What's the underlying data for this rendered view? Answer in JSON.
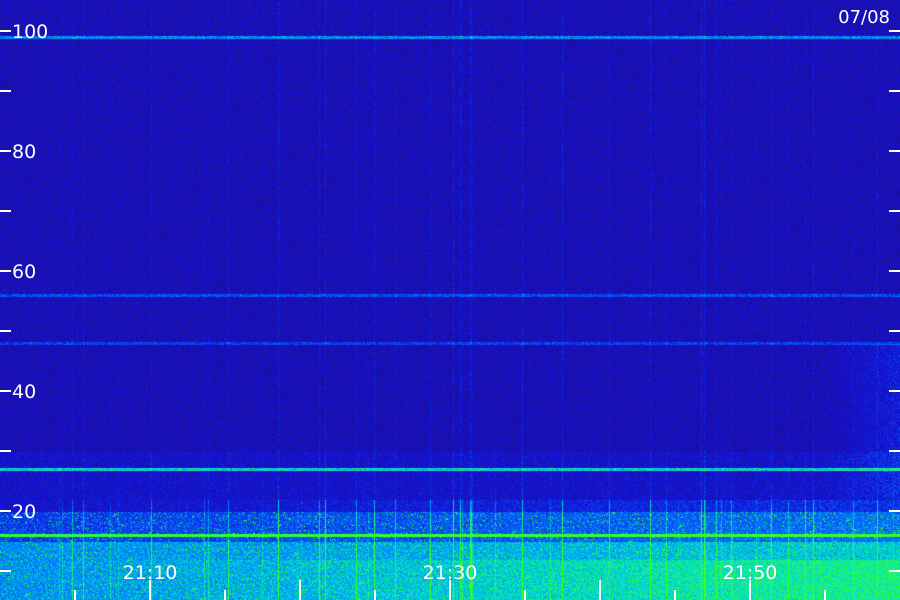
{
  "date_label": "07/08",
  "colors": {
    "background": "#2a0c78",
    "low": "#1e06a0",
    "mid": "#0050ff",
    "high": "#00e0d0",
    "peak": "#40ff40",
    "axis": "#ffffff"
  },
  "chart_data": {
    "type": "heatmap",
    "title": "",
    "xlabel": "",
    "ylabel": "",
    "ylim": [
      0,
      100
    ],
    "y_ticks_major": [
      20,
      40,
      60,
      80,
      100
    ],
    "y_ticks_minor": [
      30,
      50,
      70,
      90
    ],
    "x_tick_labels": [
      "21:10",
      "21:30",
      "21:50"
    ],
    "x_range": [
      "21:00",
      "22:00"
    ],
    "x_minor_tick_minutes": 5,
    "horizontal_lines": [
      {
        "y": 99,
        "intensity": 0.55
      },
      {
        "y": 56,
        "intensity": 0.35
      },
      {
        "y": 48,
        "intensity": 0.3
      },
      {
        "y": 27,
        "intensity": 0.7
      },
      {
        "y": 16,
        "intensity": 0.85
      }
    ],
    "bands": [
      {
        "y_from": 0,
        "y_to": 15,
        "intensity": 0.85
      },
      {
        "y_from": 15,
        "y_to": 20,
        "intensity": 0.55
      },
      {
        "y_from": 20,
        "y_to": 30,
        "intensity": 0.3
      }
    ]
  }
}
